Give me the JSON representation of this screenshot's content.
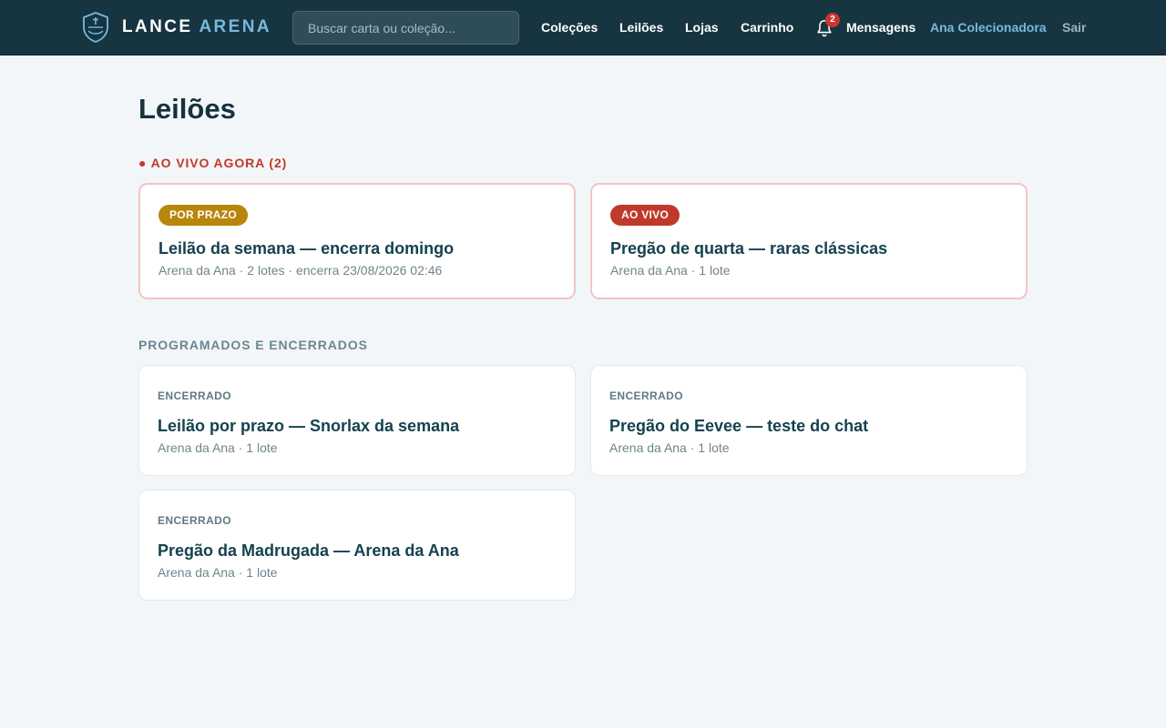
{
  "header": {
    "logo_word1": "LANCE",
    "logo_word2": "ARENA",
    "search_placeholder": "Buscar carta ou coleção...",
    "nav": {
      "colecoes": "Coleções",
      "leiloes": "Leilões",
      "lojas": "Lojas",
      "carrinho": "Carrinho",
      "mensagens": "Mensagens",
      "user": "Ana Colecionadora",
      "sair": "Sair"
    },
    "notifications_count": "2"
  },
  "page": {
    "title": "Leilões",
    "live_section": "● AO VIVO AGORA (2)",
    "past_section": "PROGRAMADOS E ENCERRADOS"
  },
  "live_auctions": [
    {
      "badge": "POR PRAZO",
      "title": "Leilão da semana — encerra domingo",
      "meta": "Arena da Ana · 2 lotes · encerra 23/08/2026 02:46"
    },
    {
      "badge": "AO VIVO",
      "title": "Pregão de quarta — raras clássicas",
      "meta": "Arena da Ana · 1 lote"
    }
  ],
  "past_auctions": [
    {
      "status": "ENCERRADO",
      "title": "Leilão por prazo — Snorlax da semana",
      "meta": "Arena da Ana · 1 lote"
    },
    {
      "status": "ENCERRADO",
      "title": "Pregão do Eevee — teste do chat",
      "meta": "Arena da Ana · 1 lote"
    },
    {
      "status": "ENCERRADO",
      "title": "Pregão da Madrugada — Arena da Ana",
      "meta": "Arena da Ana · 1 lote"
    }
  ],
  "colors": {
    "header_bg": "#163540",
    "accent": "#79b9dd",
    "live_red": "#c0392b",
    "deadline_gold": "#b8860b"
  },
  "icons": {
    "logo": "shield-logo-icon",
    "notifications": "bell-icon"
  }
}
